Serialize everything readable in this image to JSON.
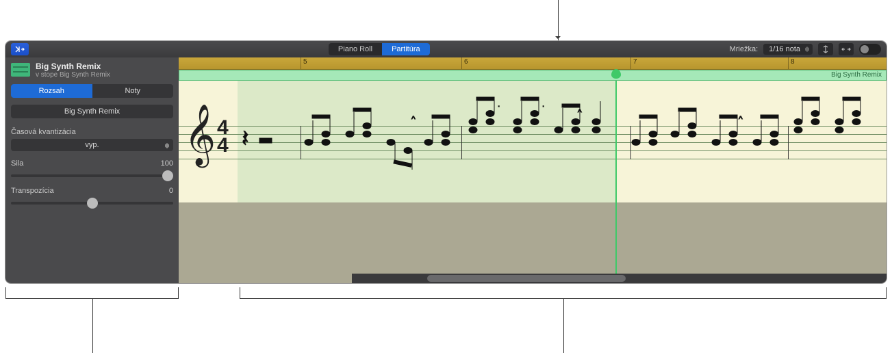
{
  "toolbar": {
    "view_pianoroll": "Piano Roll",
    "view_score": "Partitúra",
    "grid_label": "Mriežka:",
    "grid_value": "1/16 nota"
  },
  "inspector": {
    "track_name": "Big Synth Remix",
    "track_sub": "v stope Big Synth Remix",
    "mode_region": "Rozsah",
    "mode_notes": "Noty",
    "region_name": "Big Synth Remix",
    "time_quantize_label": "Časová kvantizácia",
    "time_quantize_value": "vyp.",
    "strength_label": "Sila",
    "strength_value": "100",
    "transpose_label": "Transpozícia",
    "transpose_value": "0"
  },
  "ruler": [
    "5",
    "6",
    "7",
    "8"
  ],
  "score": {
    "region_label": "Big Synth Remix",
    "timesig_top": "4",
    "timesig_bot": "4"
  }
}
